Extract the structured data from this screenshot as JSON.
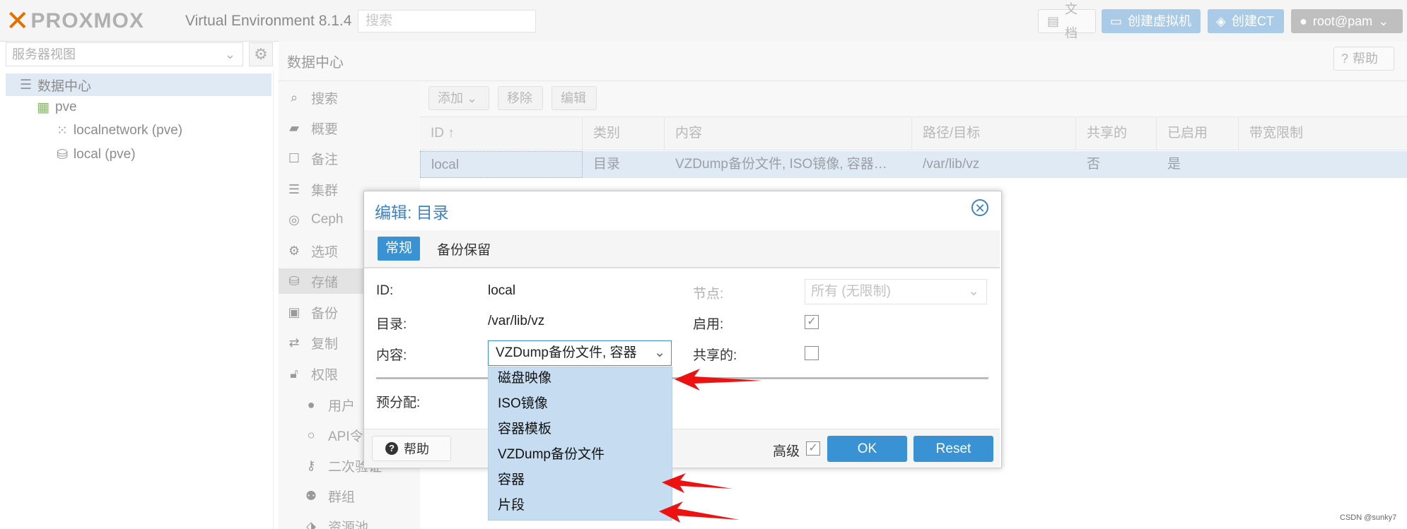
{
  "topbar": {
    "logo_text": "PROXMOX",
    "product": "Virtual Environment 8.1.4",
    "search_placeholder": "搜索",
    "docs": "文档",
    "create_vm": "创建虚拟机",
    "create_ct": "创建CT",
    "user": "root@pam"
  },
  "tree": {
    "view_label": "服务器视图",
    "items": [
      {
        "label": "数据中心",
        "icon": "datacenter-icon"
      },
      {
        "label": "pve",
        "icon": "node-icon"
      },
      {
        "label": "localnetwork (pve)",
        "icon": "network-icon"
      },
      {
        "label": "local (pve)",
        "icon": "storage-icon"
      }
    ]
  },
  "main": {
    "title": "数据中心",
    "help": "帮助",
    "nav": [
      {
        "label": "搜索",
        "icon": "search-icon"
      },
      {
        "label": "概要",
        "icon": "book-icon"
      },
      {
        "label": "备注",
        "icon": "note-icon"
      },
      {
        "label": "集群",
        "icon": "server-icon"
      },
      {
        "label": "Ceph",
        "icon": "ceph-icon"
      },
      {
        "label": "选项",
        "icon": "gear-icon"
      },
      {
        "label": "存储",
        "icon": "database-icon"
      },
      {
        "label": "备份",
        "icon": "floppy-icon"
      },
      {
        "label": "复制",
        "icon": "retweet-icon"
      },
      {
        "label": "权限",
        "icon": "unlock-icon"
      },
      {
        "label": "用户",
        "icon": "user-icon"
      },
      {
        "label": "API令",
        "icon": "user-outline-icon"
      },
      {
        "label": "二次验证",
        "icon": "key-icon"
      },
      {
        "label": "群组",
        "icon": "users-icon"
      },
      {
        "label": "资源池",
        "icon": "tags-icon"
      }
    ],
    "toolbar": {
      "add": "添加",
      "remove": "移除",
      "edit": "编辑"
    },
    "grid": {
      "columns": [
        "ID ↑",
        "类别",
        "内容",
        "路径/目标",
        "共享的",
        "已启用",
        "带宽限制"
      ],
      "rows": [
        [
          "local",
          "目录",
          "VZDump备份文件, ISO镜像, 容器…",
          "/var/lib/vz",
          "否",
          "是",
          ""
        ]
      ]
    }
  },
  "dialog": {
    "title": "编辑: 目录",
    "tabs": [
      "常规",
      "备份保留"
    ],
    "fields": {
      "id_label": "ID:",
      "id_value": "local",
      "dir_label": "目录:",
      "dir_value": "/var/lib/vz",
      "content_label": "内容:",
      "content_value": "VZDump备份文件, 容器",
      "prealloc_label": "预分配:",
      "node_label": "节点:",
      "node_value": "所有 (无限制)",
      "enable_label": "启用:",
      "enable_checked": true,
      "shared_label": "共享的:",
      "shared_checked": false
    },
    "footer": {
      "help": "帮助",
      "advanced": "高级",
      "advanced_checked": true,
      "ok": "OK",
      "reset": "Reset"
    },
    "content_options": [
      "磁盘映像",
      "ISO镜像",
      "容器模板",
      "VZDump备份文件",
      "容器",
      "片段"
    ]
  },
  "watermark": "CSDN @sunky7",
  "colors": {
    "accent": "#3892d4",
    "arrow": "#ee1111",
    "selected_row": "#dfeaf5",
    "dropdown_bg": "#c6ddf1"
  }
}
